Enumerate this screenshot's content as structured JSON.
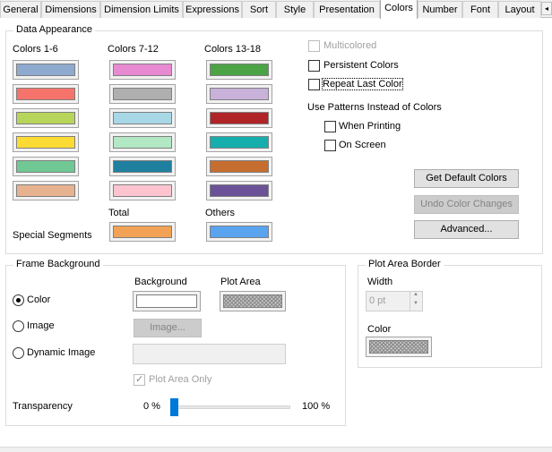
{
  "tabs": [
    {
      "label": "General"
    },
    {
      "label": "Dimensions"
    },
    {
      "label": "Dimension Limits"
    },
    {
      "label": "Expressions"
    },
    {
      "label": "Sort"
    },
    {
      "label": "Style"
    },
    {
      "label": "Presentation"
    },
    {
      "label": "Colors",
      "active": true
    },
    {
      "label": "Number"
    },
    {
      "label": "Font"
    },
    {
      "label": "Layout"
    }
  ],
  "tab_scroll_glyph": "◂",
  "data_appearance": {
    "title": "Data Appearance",
    "col1_header": "Colors 1-6",
    "col2_header": "Colors 7-12",
    "col3_header": "Colors 13-18",
    "colors_1_6": [
      "#8eaacf",
      "#f5736a",
      "#b7d55a",
      "#fcdc34",
      "#70c894",
      "#e7b28f"
    ],
    "colors_7_12": [
      "#e78ad2",
      "#afafaf",
      "#a8d8e6",
      "#b2e8c4",
      "#1f7f9f",
      "#fdc4d0"
    ],
    "colors_13_18": [
      "#4ba346",
      "#c8b2d9",
      "#b02428",
      "#16aeac",
      "#c66e30",
      "#6b5197"
    ],
    "total_label": "Total",
    "total_color": "#f2a256",
    "others_label": "Others",
    "others_color": "#5aa3ef",
    "special_segments_label": "Special Segments",
    "multicolored_label": "Multicolored",
    "persistent_colors_label": "Persistent Colors",
    "repeat_last_color_label": "Repeat Last Color",
    "use_patterns_label": "Use Patterns Instead of Colors",
    "when_printing_label": "When Printing",
    "on_screen_label": "On Screen",
    "get_default_colors_label": "Get Default Colors",
    "undo_color_changes_label": "Undo Color Changes",
    "advanced_label": "Advanced..."
  },
  "frame_background": {
    "title": "Frame Background",
    "background_header": "Background",
    "plot_area_header": "Plot Area",
    "color_label": "Color",
    "image_label": "Image",
    "image_button_label": "Image...",
    "dynamic_image_label": "Dynamic Image",
    "plot_area_only_label": "Plot Area Only",
    "transparency_label": "Transparency",
    "transparency_min": "0 %",
    "transparency_max": "100 %",
    "transparency_value": 0,
    "background_color": "#ffffff"
  },
  "plot_area_border": {
    "title": "Plot Area Border",
    "width_label": "Width",
    "width_value": "0 pt",
    "color_label": "Color"
  }
}
